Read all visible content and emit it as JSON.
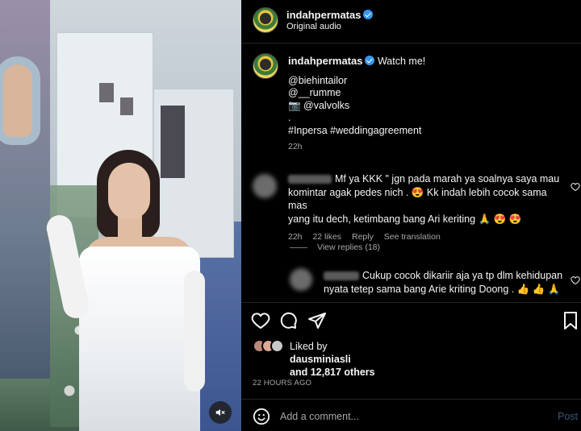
{
  "header": {
    "username": "indahpermatas",
    "subtitle": "Original audio"
  },
  "caption": {
    "username": "indahpermatas",
    "text": "Watch me!",
    "lines": [
      "@biehintailor",
      "@__rumme",
      "📷 @valvolks",
      ".",
      "#Inpersa #weddingagreement"
    ],
    "time": "22h"
  },
  "comments": [
    {
      "text_line1": "Mf ya KKK \" jgn pada marah ya soalnya saya mau",
      "text_line2": "komintar agak pedes nich . 😍  Kk indah lebih cocok sama mas",
      "text_line3": "yang itu dech, ketimbang bang Ari keriting 🙏 😍 😍",
      "time": "22h",
      "likes": "22 likes",
      "reply": "Reply",
      "translate": "See translation"
    }
  ],
  "view_replies": "View replies (18)",
  "reply": {
    "text_line1": "Cukup cocok dikariir aja ya tp dlm kehidupan",
    "text_line2": "nyata tetep sama bang Arie kriting Doong . 👍 👍 🙏"
  },
  "likes": {
    "liked_by_prefix": "Liked by",
    "liked_by_user": "dausminiasli",
    "and_text": "and 12,817 others"
  },
  "post_time": "22 HOURS AGO",
  "add_comment": {
    "placeholder": "Add a comment...",
    "post_label": "Post"
  },
  "colors": {
    "background": "#000000",
    "text": "#f5f5f5",
    "muted": "#a8a8a8",
    "verified": "#3897f0",
    "post_disabled": "#3b5a7a"
  },
  "icons": [
    "mute-icon",
    "heart-icon",
    "comment-icon",
    "share-icon",
    "bookmark-icon",
    "emoji-icon",
    "verified-icon"
  ]
}
